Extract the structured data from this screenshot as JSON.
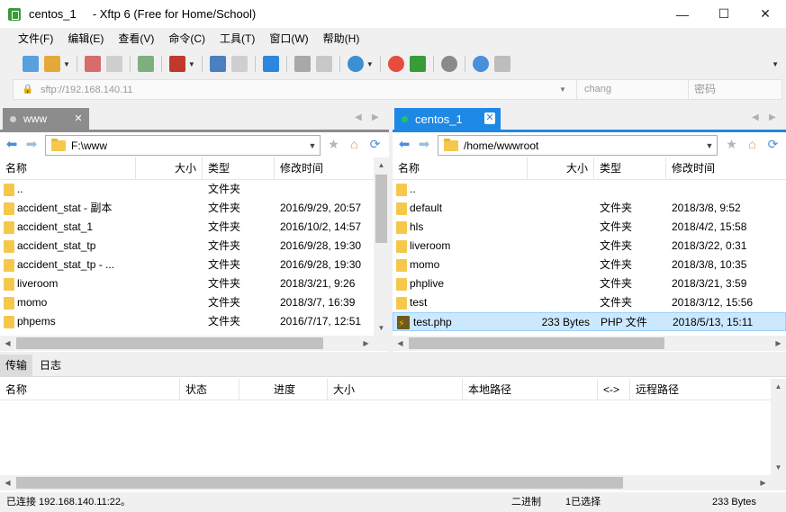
{
  "window": {
    "title": "centos_1     - Xftp 6 (Free for Home/School)",
    "minimize": "—",
    "maximize": "☐",
    "close": "✕"
  },
  "menu": [
    "文件(F)",
    "编辑(E)",
    "查看(V)",
    "命令(C)",
    "工具(T)",
    "窗口(W)",
    "帮助(H)"
  ],
  "address": {
    "host_placeholder": "sftp://192.168.140.11",
    "user_placeholder": "chang",
    "password_placeholder": "密码"
  },
  "left": {
    "tab_label": "www",
    "path": "F:\\www",
    "columns": [
      "名称",
      "大小",
      "类型",
      "修改时间"
    ],
    "rows": [
      {
        "name": "..",
        "size": "",
        "type": "文件夹",
        "mtime": ""
      },
      {
        "name": "accident_stat - 副本",
        "size": "",
        "type": "文件夹",
        "mtime": "2016/9/29, 20:57"
      },
      {
        "name": "accident_stat_1",
        "size": "",
        "type": "文件夹",
        "mtime": "2016/10/2, 14:57"
      },
      {
        "name": "accident_stat_tp",
        "size": "",
        "type": "文件夹",
        "mtime": "2016/9/28, 19:30"
      },
      {
        "name": "accident_stat_tp - ...",
        "size": "",
        "type": "文件夹",
        "mtime": "2016/9/28, 19:30"
      },
      {
        "name": "liveroom",
        "size": "",
        "type": "文件夹",
        "mtime": "2018/3/21, 9:26"
      },
      {
        "name": "momo",
        "size": "",
        "type": "文件夹",
        "mtime": "2018/3/7, 16:39"
      },
      {
        "name": "phpems",
        "size": "",
        "type": "文件夹",
        "mtime": "2016/7/17, 12:51"
      }
    ]
  },
  "right": {
    "tab_label": "centos_1",
    "path": "/home/wwwroot",
    "columns": [
      "名称",
      "大小",
      "类型",
      "修改时间"
    ],
    "rows": [
      {
        "name": "..",
        "size": "",
        "type": "",
        "mtime": "",
        "kind": "folder"
      },
      {
        "name": "default",
        "size": "",
        "type": "文件夹",
        "mtime": "2018/3/8, 9:52",
        "kind": "folder"
      },
      {
        "name": "hls",
        "size": "",
        "type": "文件夹",
        "mtime": "2018/4/2, 15:58",
        "kind": "folder"
      },
      {
        "name": "liveroom",
        "size": "",
        "type": "文件夹",
        "mtime": "2018/3/22, 0:31",
        "kind": "folder"
      },
      {
        "name": "momo",
        "size": "",
        "type": "文件夹",
        "mtime": "2018/3/8, 10:35",
        "kind": "folder"
      },
      {
        "name": "phplive",
        "size": "",
        "type": "文件夹",
        "mtime": "2018/3/21, 3:59",
        "kind": "folder"
      },
      {
        "name": "test",
        "size": "",
        "type": "文件夹",
        "mtime": "2018/3/12, 15:56",
        "kind": "folder"
      },
      {
        "name": "test.php",
        "size": "233 Bytes",
        "type": "PHP 文件",
        "mtime": "2018/5/13, 15:11",
        "kind": "php",
        "selected": true
      }
    ]
  },
  "transfer": {
    "tabs": [
      "传输",
      "日志"
    ],
    "columns": [
      "名称",
      "状态",
      "进度",
      "大小",
      "本地路径",
      "<->",
      "远程路径"
    ]
  },
  "status": {
    "connection": "已连接 192.168.140.11:22。",
    "mode": "二进制",
    "selection": "1已选择",
    "size": "233 Bytes"
  },
  "colors": {
    "active_tab": "#1e88e5",
    "inactive_tab": "#8c8c8c",
    "connected_dot": "#22c55e",
    "selection_bg": "#cce8ff"
  }
}
